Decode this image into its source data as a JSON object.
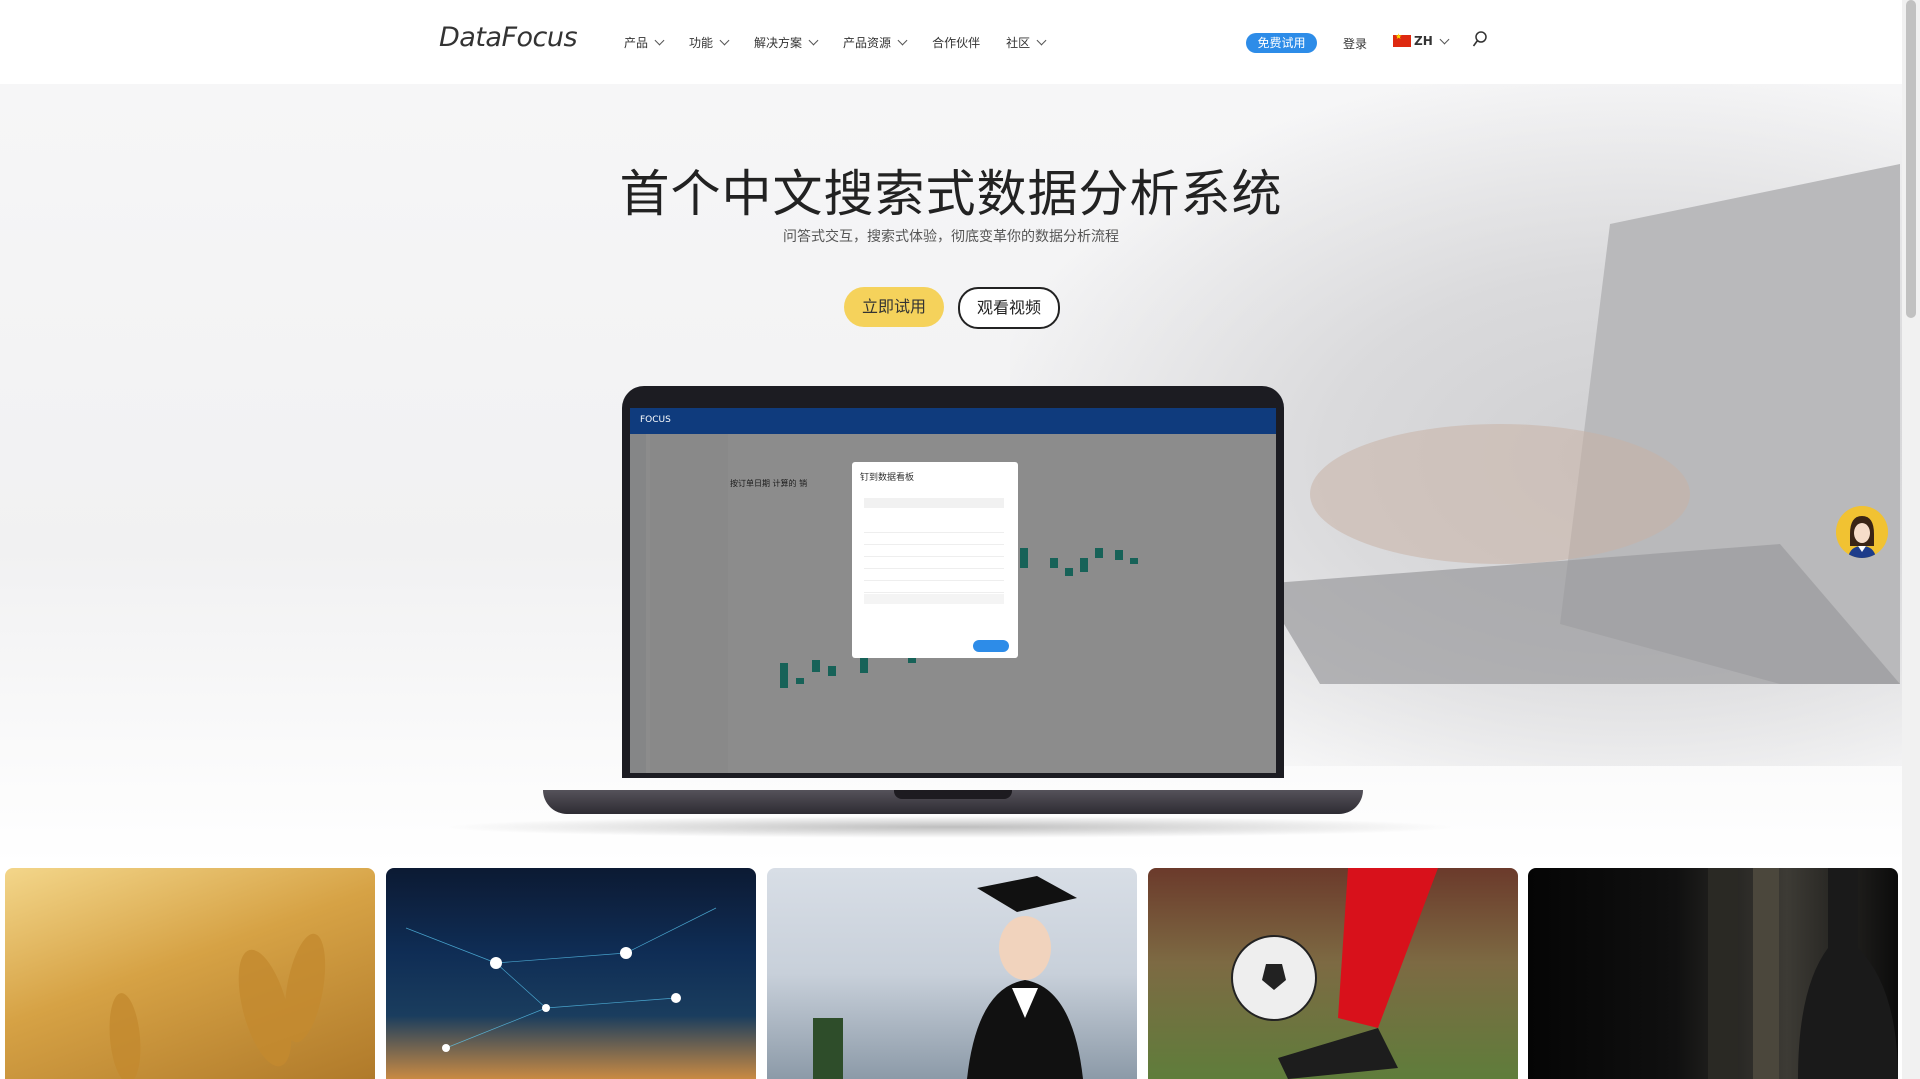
{
  "header": {
    "logo": "DataFocus",
    "nav": [
      {
        "label": "产品",
        "dropdown": true
      },
      {
        "label": "功能",
        "dropdown": true
      },
      {
        "label": "解决方案",
        "dropdown": true
      },
      {
        "label": "产品资源",
        "dropdown": true
      },
      {
        "label": "合作伙伴",
        "dropdown": false
      },
      {
        "label": "社区",
        "dropdown": true
      }
    ],
    "trial_button": "免费试用",
    "login": "登录",
    "language": "ZH",
    "search_icon": "search-icon"
  },
  "hero": {
    "title": "首个中文搜索式数据分析系统",
    "subtitle": "问答式交互，搜索式体验，彻底变革你的数据分析流程",
    "primary_button": "立即试用",
    "secondary_button": "观看视频",
    "accent_color": "#f5d25b"
  },
  "mockup": {
    "app_brand": "FOCUS",
    "modal_title": "钉到数据看板",
    "chart_label": "按订单日期 计算的 销"
  },
  "colors": {
    "brand_blue": "#2d8ce8",
    "nav_dark": "#0f3b7d"
  }
}
